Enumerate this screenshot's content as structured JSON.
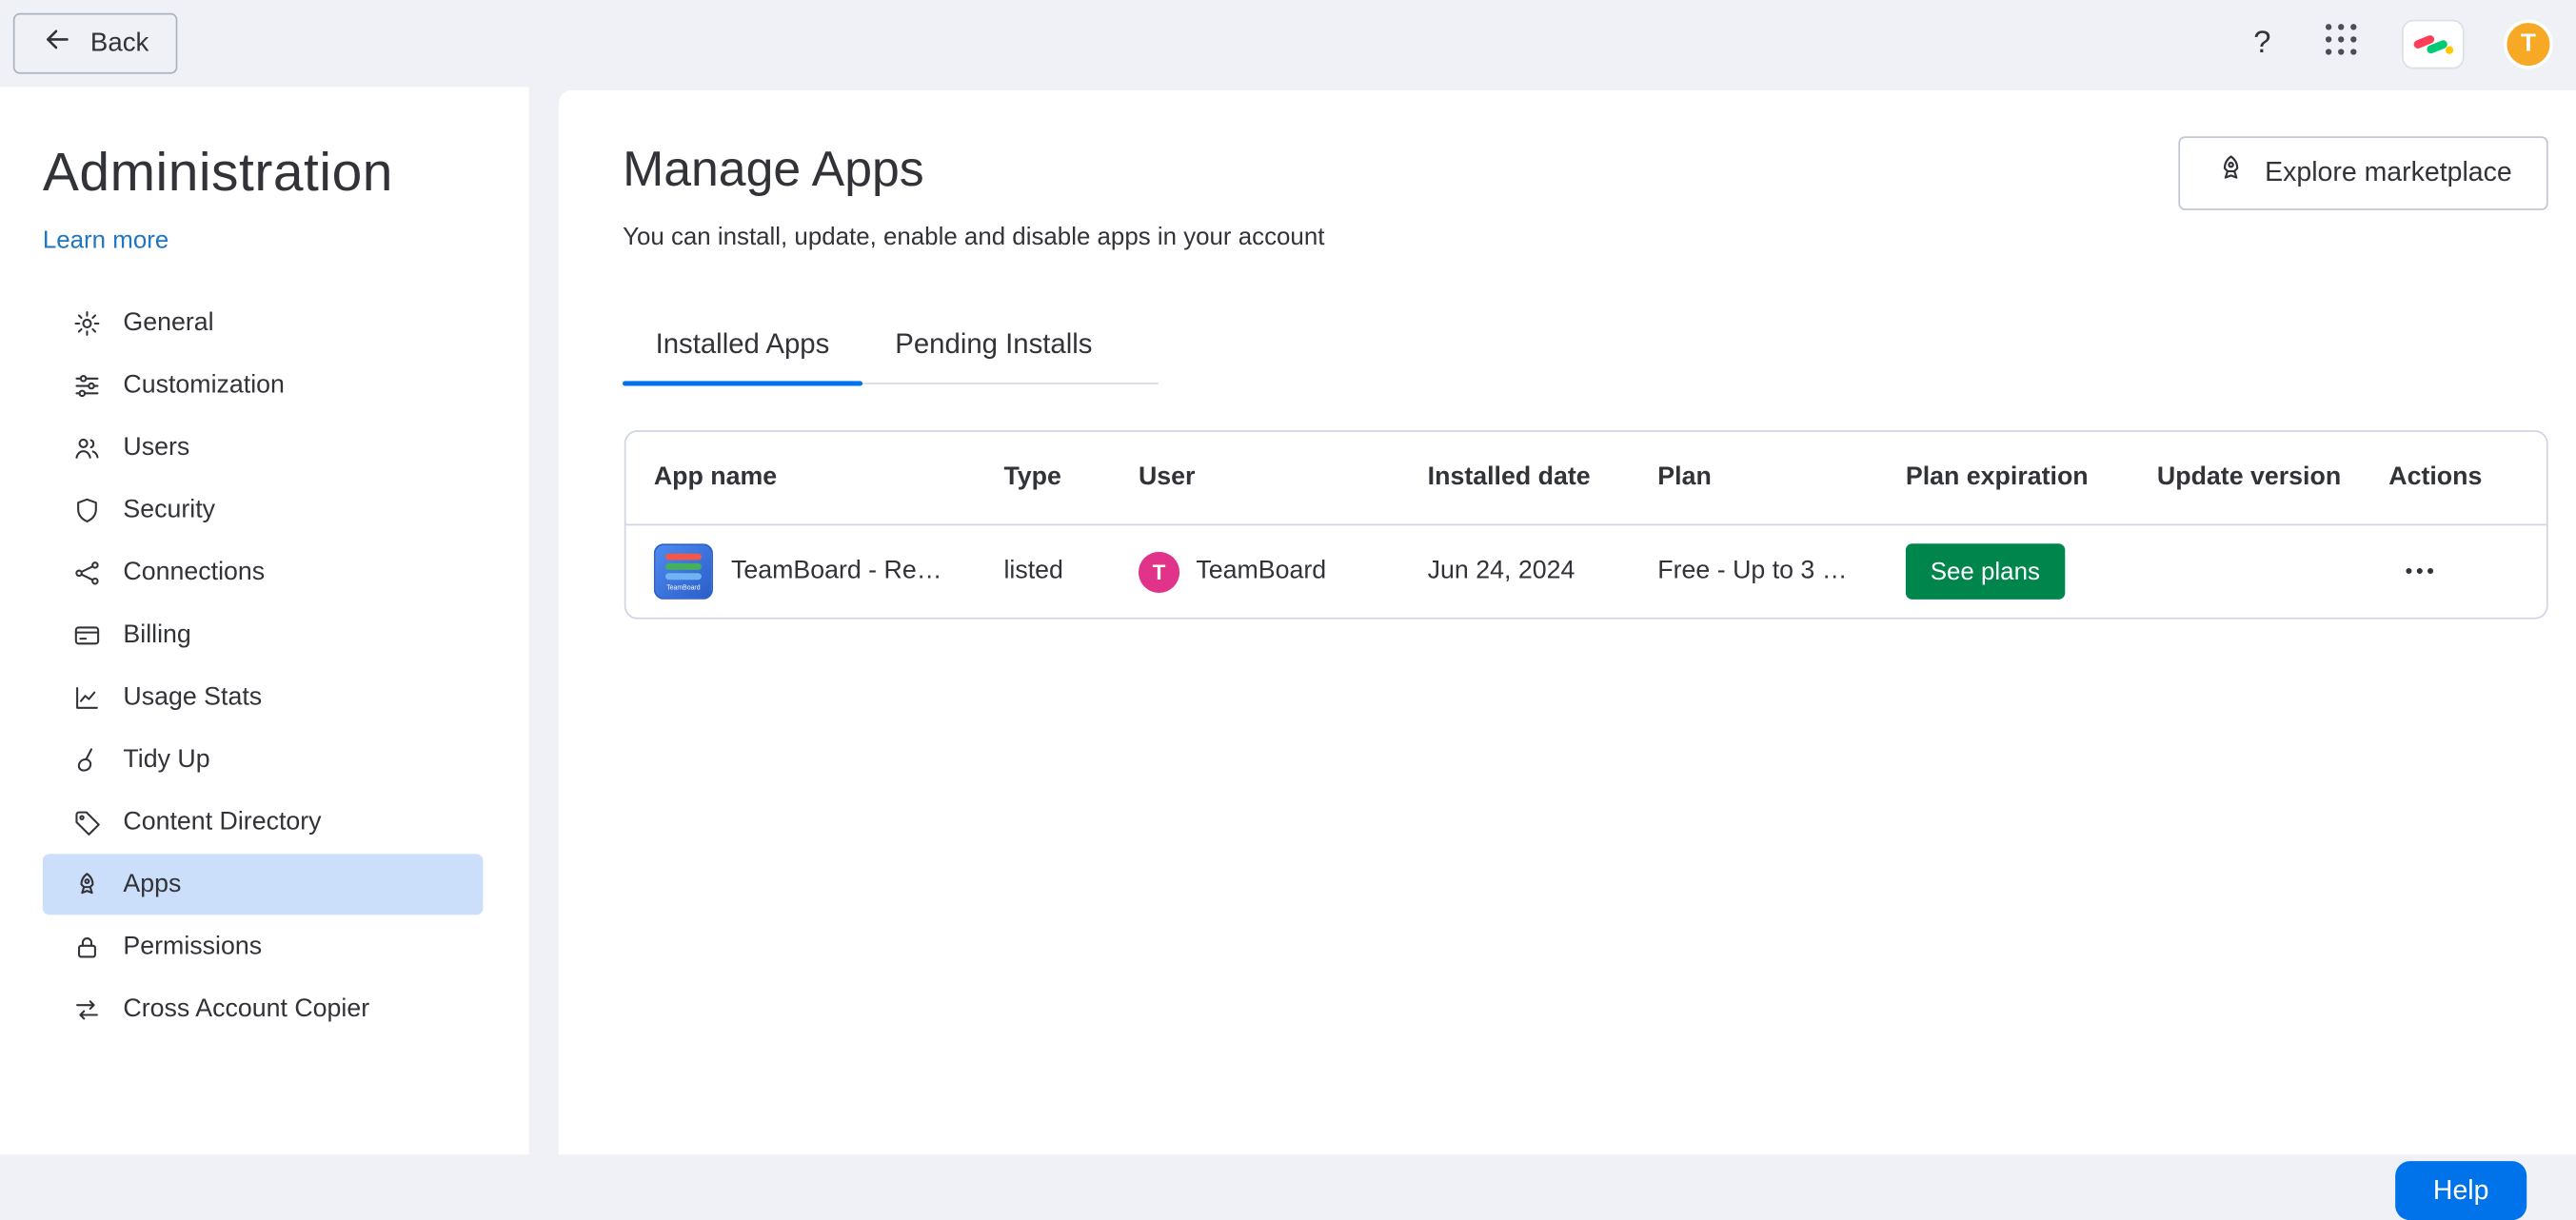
{
  "topbar": {
    "back_label": "Back",
    "question_mark": "?",
    "avatar_initial": "T"
  },
  "sidebar": {
    "title": "Administration",
    "learn_more_label": "Learn more",
    "items": [
      {
        "label": "General",
        "icon": "gear-icon"
      },
      {
        "label": "Customization",
        "icon": "sliders-icon"
      },
      {
        "label": "Users",
        "icon": "users-icon"
      },
      {
        "label": "Security",
        "icon": "shield-icon"
      },
      {
        "label": "Connections",
        "icon": "share-nodes-icon"
      },
      {
        "label": "Billing",
        "icon": "credit-card-icon"
      },
      {
        "label": "Usage Stats",
        "icon": "chart-icon"
      },
      {
        "label": "Tidy Up",
        "icon": "broom-icon"
      },
      {
        "label": "Content Directory",
        "icon": "tag-icon"
      },
      {
        "label": "Apps",
        "icon": "rocket-icon",
        "selected": true
      },
      {
        "label": "Permissions",
        "icon": "lock-icon"
      },
      {
        "label": "Cross Account Copier",
        "icon": "transfer-arrows-icon"
      }
    ]
  },
  "main": {
    "title": "Manage Apps",
    "subtitle": "You can install, update, enable and disable apps in your account",
    "explore_button_label": "Explore marketplace",
    "tabs": [
      {
        "label": "Installed Apps",
        "active": true
      },
      {
        "label": "Pending Installs",
        "active": false
      }
    ],
    "table": {
      "columns": [
        "App name",
        "Type",
        "User",
        "Installed date",
        "Plan",
        "Plan expiration",
        "Update version",
        "Actions"
      ],
      "rows": [
        {
          "app_name": "TeamBoard - Re…",
          "app_logo_text": "TeamBoard",
          "type": "listed",
          "user_initial": "T",
          "user_name": "TeamBoard",
          "installed_date": "Jun 24, 2024",
          "plan": "Free - Up to 3 …",
          "plan_expiration_action": "See plans",
          "update_version": "",
          "actions_dots": "•••"
        }
      ]
    }
  },
  "help_button_label": "Help",
  "colors": {
    "accent_blue": "#0073ea",
    "link_blue": "#1f76c2",
    "selected_item_bg": "#cbdffb",
    "see_plans_green": "#00854d",
    "user_avatar_pink": "#e2338b",
    "topbar_avatar_orange": "#f7a824",
    "page_bg": "#eff1f6"
  }
}
